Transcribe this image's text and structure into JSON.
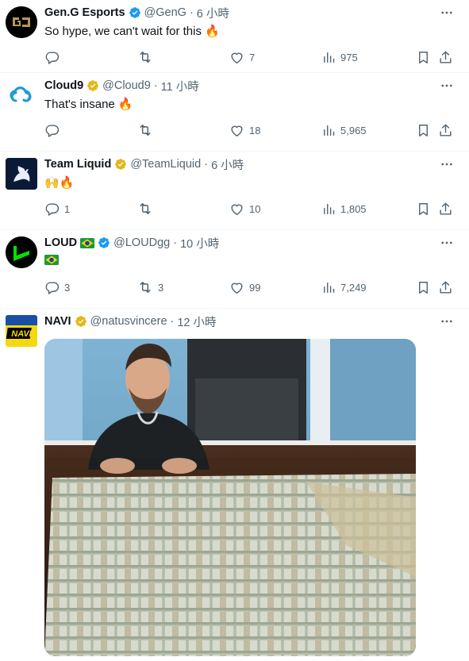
{
  "tweets": [
    {
      "name": "Gen.G Esports",
      "handle": "@GenG",
      "time": "6 小時",
      "text": "So hype, we can't wait for this",
      "emoji": "🔥",
      "badge": "verified-blue",
      "replies": "",
      "retweets": "",
      "likes": "7",
      "views": "975"
    },
    {
      "name": "Cloud9",
      "handle": "@Cloud9",
      "time": "11 小時",
      "text": "That's insane",
      "emoji": "🔥",
      "badge": "verified-gold",
      "replies": "",
      "retweets": "",
      "likes": "18",
      "views": "5,965"
    },
    {
      "name": "Team Liquid",
      "handle": "@TeamLiquid",
      "time": "6 小時",
      "text": "",
      "emoji": "🙌🔥",
      "badge": "verified-gold",
      "replies": "1",
      "retweets": "",
      "likes": "10",
      "views": "1,805"
    },
    {
      "name": "LOUD",
      "handle": "@LOUDgg",
      "time": "10 小時",
      "text": "",
      "emoji": "🇧🇷",
      "badge": "verified-blue",
      "replies": "3",
      "retweets": "3",
      "likes": "99",
      "views": "7,249"
    },
    {
      "name": "NAVI",
      "handle": "@natusvincere",
      "time": "12 小時",
      "text": "",
      "emoji": "",
      "badge": "verified-gold",
      "logo_text": "NAVI"
    }
  ],
  "separator": "·",
  "colors": {
    "blue_badge": "#1d9bf0",
    "gold_badge": "#e2b719",
    "muted": "#536471"
  }
}
